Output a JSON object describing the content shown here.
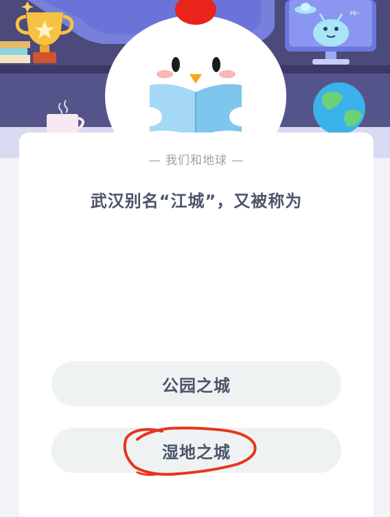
{
  "quiz": {
    "category": "— 我们和地球 —",
    "question": "武汉别名“江城”，又被称为",
    "options": [
      {
        "label": "公园之城"
      },
      {
        "label": "湿地之城"
      }
    ],
    "selected_option": 1
  },
  "hero": {
    "speech_text": "Hi~"
  },
  "colors": {
    "hero_background": "#4b4a7a",
    "card": "#ffffff",
    "option_background": "#eef2f2",
    "text_primary": "#4a5568",
    "text_secondary": "#9aa1ab",
    "scribble": "#e8341c"
  },
  "icons": [
    "trophy-icon",
    "chick-mascot",
    "alien-icon",
    "ufo-icon",
    "earth-globe-icon",
    "tea-cup-icon",
    "books-icon"
  ]
}
